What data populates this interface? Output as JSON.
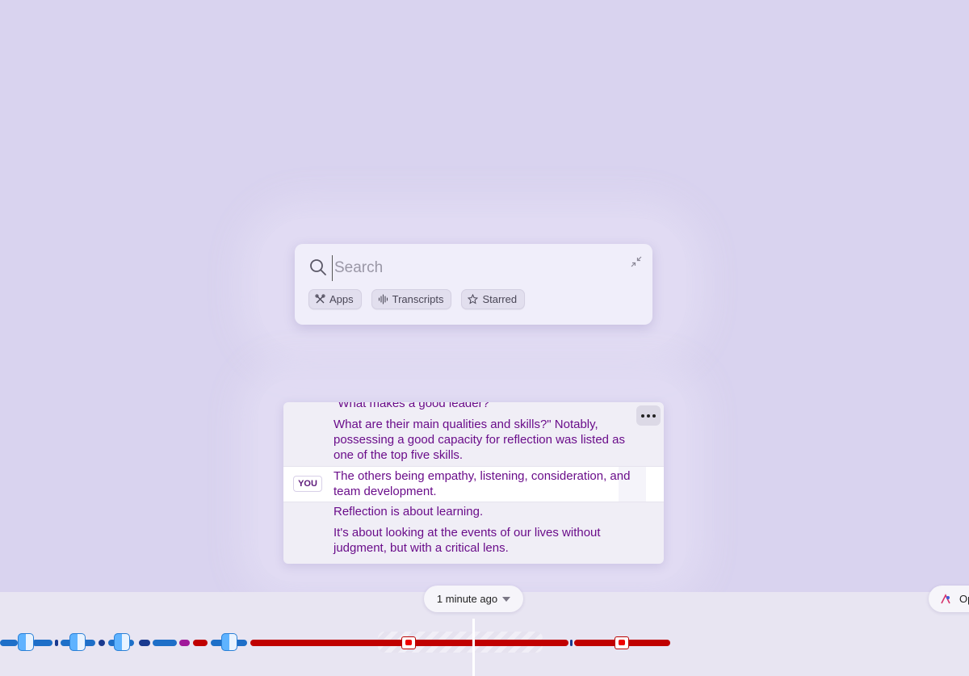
{
  "search": {
    "placeholder": "Search",
    "chips": [
      {
        "label": "Apps",
        "icon": "apps-icon"
      },
      {
        "label": "Transcripts",
        "icon": "waveform-icon"
      },
      {
        "label": "Starred",
        "icon": "star-icon"
      }
    ]
  },
  "transcript": {
    "lines": [
      "\"What makes a good leader?",
      "What are their main qualities and skills?\" Notably, possessing a good capacity for reflection was listed as one of the top five skills.",
      "The others being empathy, listening, consideration, and team development.",
      "Reflection is about learning.",
      "It's about looking at the events of our lives without judgment, but with a critical lens."
    ],
    "speaker_badge": "YOU",
    "more_label": "More options"
  },
  "timeline": {
    "time_label": "1 minute ago",
    "open_label": "Op",
    "colors": {
      "finder": "#1e6fc8",
      "youtube": "#c00000",
      "magenta": "#a0189a"
    }
  }
}
